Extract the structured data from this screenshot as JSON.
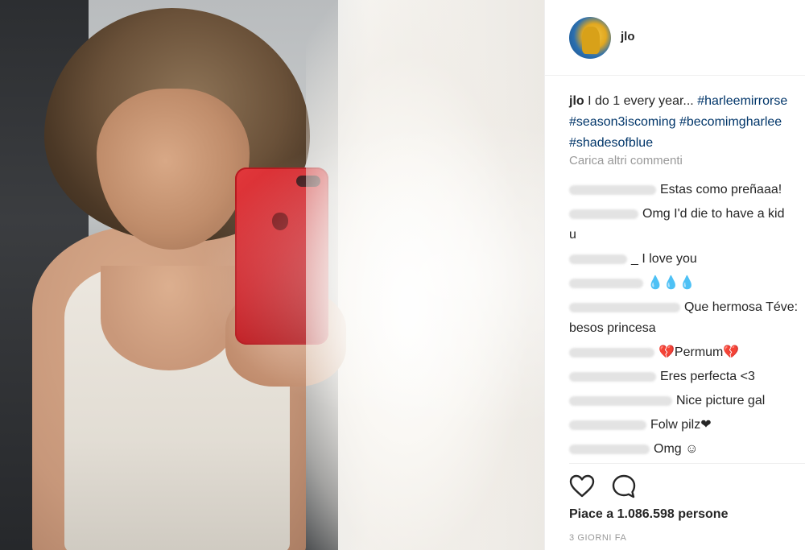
{
  "post": {
    "username": "jlo",
    "caption": {
      "user": "jlo",
      "text": "I do 1 every year... ",
      "tag1": "#harleemirrorse",
      "tag2": "#season3iscoming",
      "tag3": "#becomimgharlee",
      "tag4": "#shadesofblue"
    },
    "load_more": "Carica altri commenti",
    "comments": [
      {
        "text": "Estas como preñaaa!",
        "cont": ""
      },
      {
        "text": "Omg I'd die to have a kid",
        "cont": "u"
      },
      {
        "text": "_ I love you",
        "cont": ""
      },
      {
        "text": "💧💧💧",
        "cont": ""
      },
      {
        "text": "Que hermosa Téve:",
        "cont": "besos princesa"
      },
      {
        "text": "💔Permum💔",
        "cont": ""
      },
      {
        "text": "Eres perfecta <3",
        "cont": ""
      },
      {
        "text": "Nice picture gal",
        "cont": ""
      },
      {
        "text": "Folw pilz❤",
        "cont": ""
      },
      {
        "text": "Omg ☺",
        "cont": ""
      }
    ],
    "likes": "Piace a 1.086.598 persone",
    "time": "3 GIORNI FA"
  },
  "icons": {
    "like": "heart-icon",
    "comment": "speech-bubble-icon"
  },
  "colors": {
    "hashtag": "#003569",
    "muted": "#999999",
    "text": "#262626"
  }
}
